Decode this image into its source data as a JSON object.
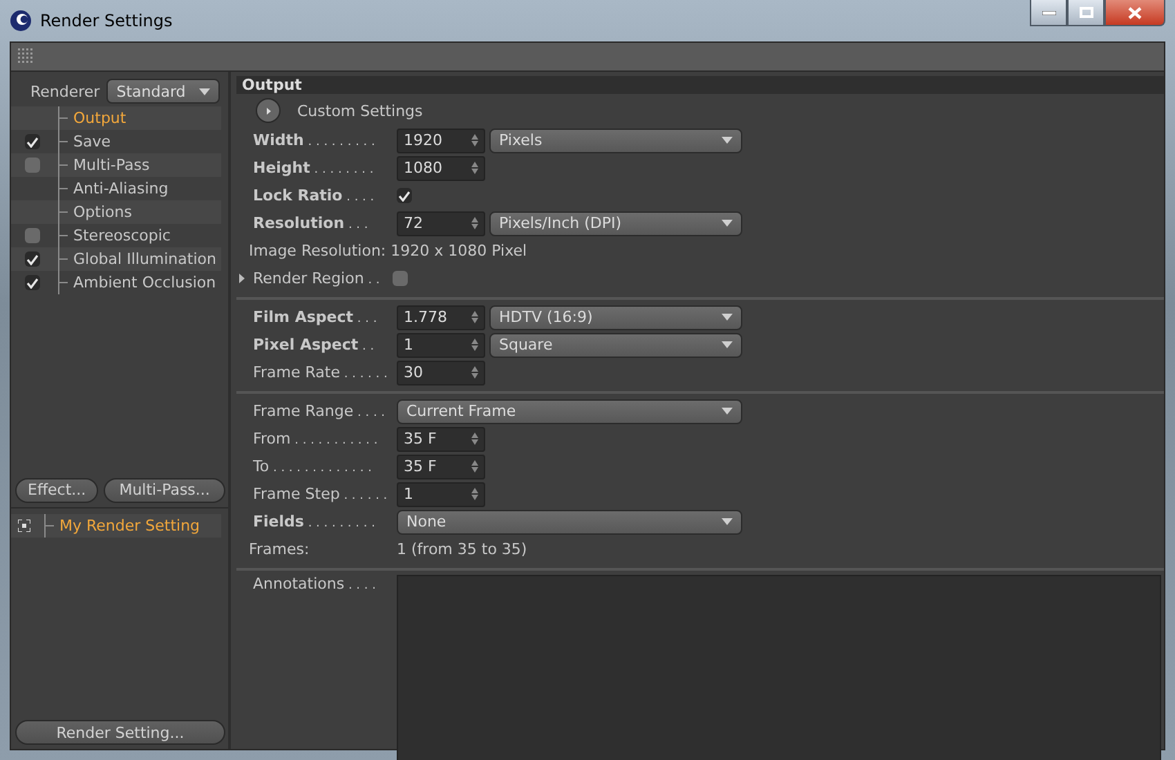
{
  "window": {
    "title": "Render Settings"
  },
  "renderer": {
    "label": "Renderer",
    "value": "Standard"
  },
  "sidebar": {
    "items": [
      {
        "label": "Output",
        "kind": "plain",
        "selected": true
      },
      {
        "label": "Save",
        "kind": "check",
        "checked": true,
        "selected": false
      },
      {
        "label": "Multi-Pass",
        "kind": "check",
        "checked": false,
        "selected": false
      },
      {
        "label": "Anti-Aliasing",
        "kind": "plain",
        "selected": false
      },
      {
        "label": "Options",
        "kind": "plain",
        "selected": false
      },
      {
        "label": "Stereoscopic",
        "kind": "check",
        "checked": false,
        "selected": false
      },
      {
        "label": "Global Illumination",
        "kind": "check",
        "checked": true,
        "selected": false
      },
      {
        "label": "Ambient Occlusion",
        "kind": "check",
        "checked": true,
        "selected": false
      }
    ],
    "buttons": [
      "Effect...",
      "Multi-Pass..."
    ],
    "settings": [
      {
        "label": "My Render Setting",
        "selected": true
      }
    ],
    "bottom_button": "Render Setting..."
  },
  "panel": {
    "title": "Output",
    "custom_settings": "Custom Settings",
    "sections": [
      [
        {
          "kind": "number_dropdown",
          "label": "Width",
          "dots": ". . . . . . . . .",
          "bold": true,
          "value": "1920",
          "option": "Pixels"
        },
        {
          "kind": "number",
          "label": "Height",
          "dots": ". . . . . . . .",
          "bold": true,
          "value": "1080"
        },
        {
          "kind": "checkbox",
          "label": "Lock Ratio",
          "dots": ". . . .",
          "bold": true,
          "checked": true
        },
        {
          "kind": "number_dropdown",
          "label": "Resolution",
          "dots": ". . .",
          "bold": true,
          "value": "72",
          "option": "Pixels/Inch (DPI)"
        },
        {
          "kind": "info",
          "label": "Image Resolution:",
          "value": "1920 x 1080 Pixel"
        },
        {
          "kind": "expander",
          "label": "Render Region",
          "dots": ". .",
          "bold": false,
          "checked": false
        }
      ],
      [
        {
          "kind": "number_dropdown",
          "label": "Film Aspect",
          "dots": ". . .",
          "bold": true,
          "value": "1.778",
          "option": "HDTV (16:9)"
        },
        {
          "kind": "number_dropdown",
          "label": "Pixel Aspect",
          "dots": ". .",
          "bold": true,
          "value": "1",
          "option": "Square"
        },
        {
          "kind": "number",
          "label": "Frame Rate",
          "dots": ". . . . . .",
          "bold": false,
          "value": "30"
        }
      ],
      [
        {
          "kind": "dropdown",
          "label": "Frame Range",
          "dots": ". . . .",
          "bold": false,
          "option": "Current Frame"
        },
        {
          "kind": "number",
          "label": "From",
          "dots": ". . . . . . . . . . .",
          "bold": false,
          "value": "35 F"
        },
        {
          "kind": "number",
          "label": "To",
          "dots": ". . . . . . . . . . . . .",
          "bold": false,
          "value": "35 F"
        },
        {
          "kind": "number",
          "label": "Frame Step",
          "dots": ". . . . . .",
          "bold": false,
          "value": "1"
        },
        {
          "kind": "dropdown",
          "label": "Fields",
          "dots": ". . . . . . . . .",
          "bold": true,
          "option": "None"
        },
        {
          "kind": "frames",
          "label": "Frames:",
          "value": "1 (from 35 to 35)"
        }
      ],
      [
        {
          "kind": "textarea",
          "label": "Annotations",
          "dots": ". . . .",
          "bold": false
        }
      ]
    ]
  }
}
